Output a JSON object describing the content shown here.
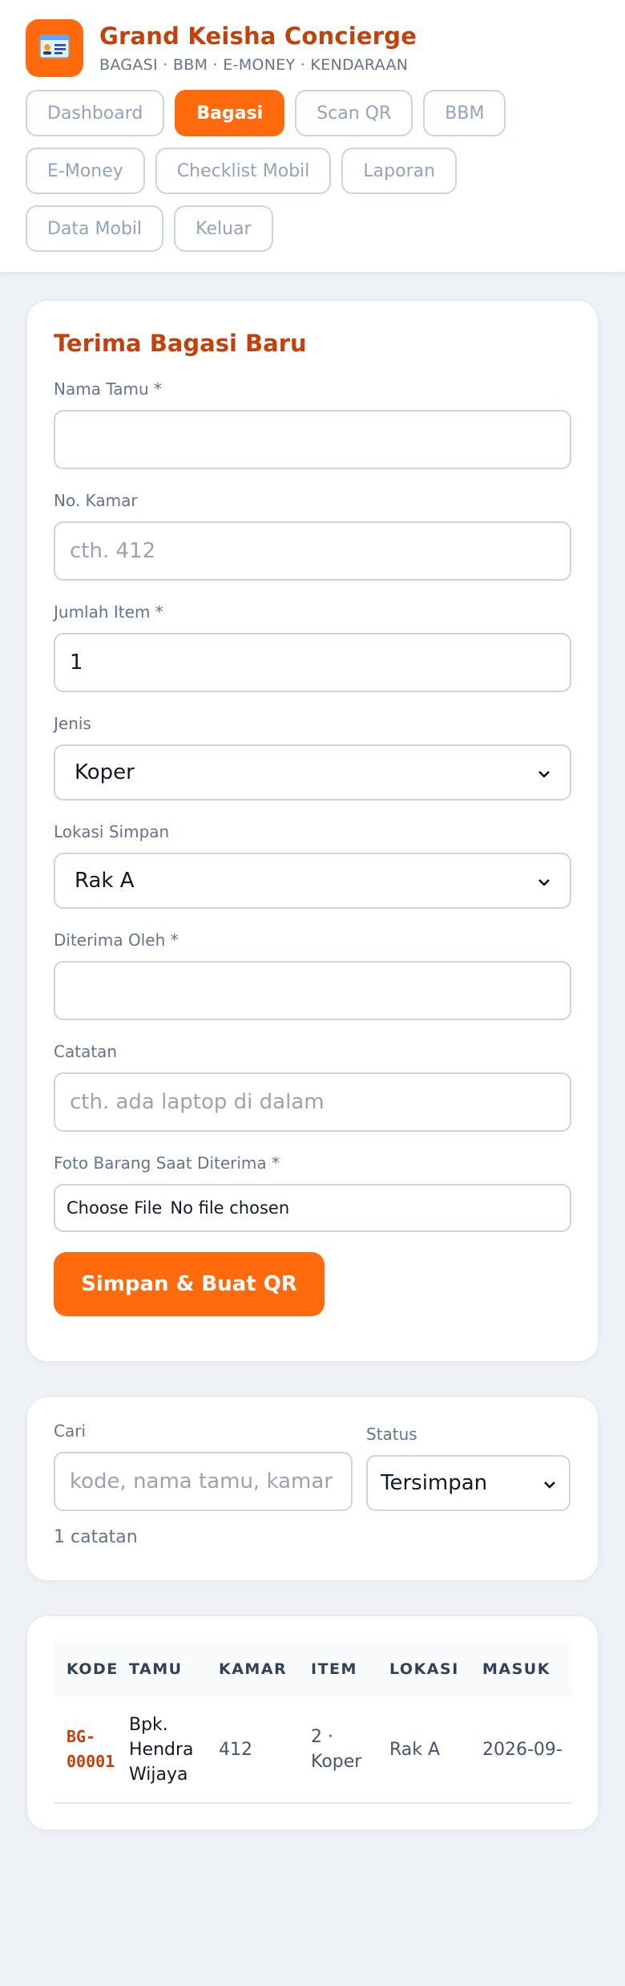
{
  "app": {
    "title": "Grand Keisha Concierge",
    "subtitle": "BAGASI · BBM · E-MONEY · KENDARAAN",
    "accent": "#ff6a0c",
    "title_color": "#c2410c",
    "logo_icon": "id-card-icon"
  },
  "nav": [
    {
      "label": "Dashboard",
      "active": false
    },
    {
      "label": "Bagasi",
      "active": true
    },
    {
      "label": "Scan QR",
      "active": false
    },
    {
      "label": "BBM",
      "active": false
    },
    {
      "label": "E-Money",
      "active": false
    },
    {
      "label": "Checklist Mobil",
      "active": false
    },
    {
      "label": "Laporan",
      "active": false
    },
    {
      "label": "Data Mobil",
      "active": false
    },
    {
      "label": "Keluar",
      "active": false
    }
  ],
  "form": {
    "title": "Terima Bagasi Baru",
    "guest_name": {
      "label": "Nama Tamu *",
      "value": "",
      "placeholder": ""
    },
    "room": {
      "label": "No. Kamar",
      "value": "",
      "placeholder": "cth. 412"
    },
    "qty": {
      "label": "Jumlah Item *",
      "value": "1"
    },
    "type": {
      "label": "Jenis",
      "value": "Koper"
    },
    "location": {
      "label": "Lokasi Simpan",
      "value": "Rak A"
    },
    "received_by": {
      "label": "Diterima Oleh *",
      "value": ""
    },
    "notes": {
      "label": "Catatan",
      "value": "",
      "placeholder": "cth. ada laptop di dalam"
    },
    "photo": {
      "label": "Foto Barang Saat Diterima *",
      "choose_label": "Choose File",
      "status": "No file chosen"
    },
    "submit_label": "Simpan & Buat QR"
  },
  "filter": {
    "search_label": "Cari",
    "search_placeholder": "kode, nama tamu, kamar",
    "status_label": "Status",
    "status_value": "Tersimpan",
    "count_text": "1 catatan"
  },
  "table": {
    "headers": [
      "KODE",
      "TAMU",
      "KAMAR",
      "ITEM",
      "LOKASI",
      "MASUK"
    ],
    "rows": [
      {
        "code": "BG-00001",
        "guest": "Bpk. Hendra Wijaya",
        "room": "412",
        "item": "2 · Koper",
        "location": "Rak A",
        "in": "2026-09-"
      }
    ]
  }
}
